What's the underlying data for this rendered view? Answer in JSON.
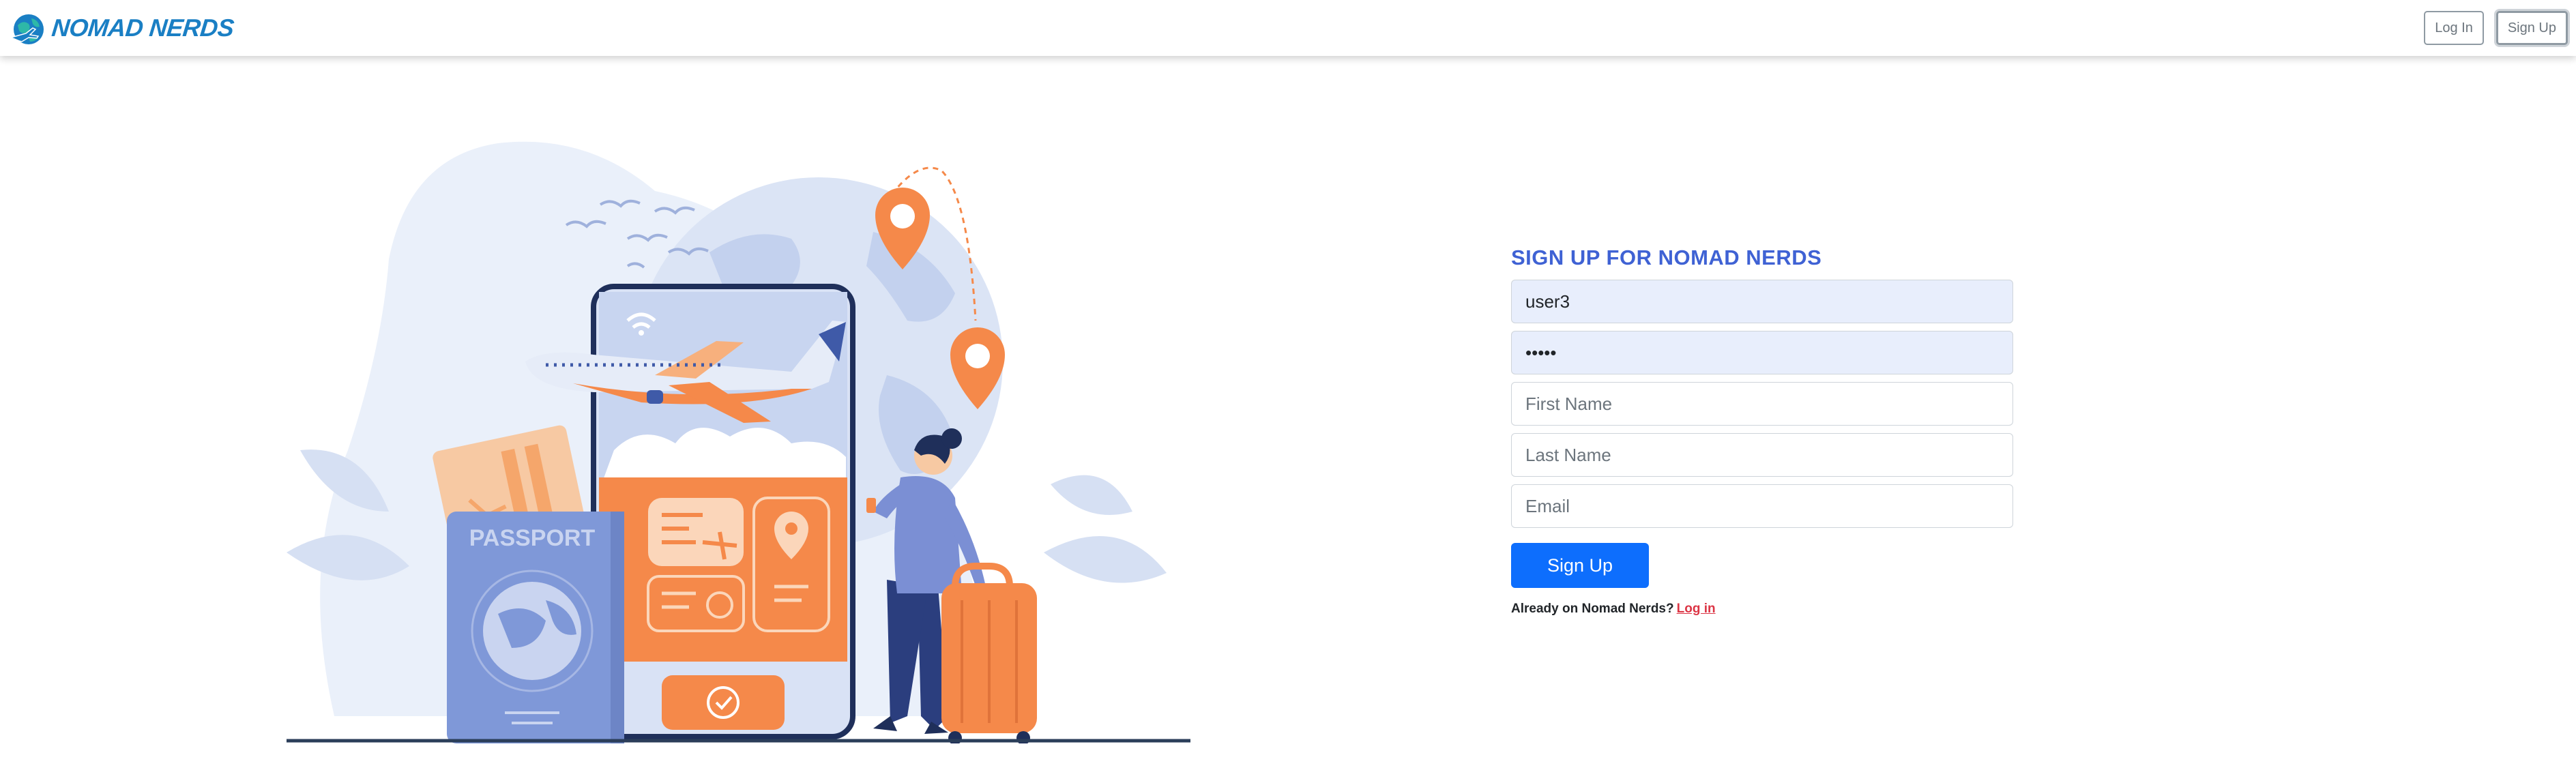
{
  "brand": {
    "name": "NOMAD NERDS",
    "logo_icon": "globe-plane-icon",
    "color": "#1a7fc4"
  },
  "nav": {
    "login_label": "Log In",
    "signup_label": "Sign Up"
  },
  "illustration": {
    "passport_text": "PASSPORT"
  },
  "form": {
    "title": "SIGN UP FOR NOMAD NERDS",
    "username_value": "user3",
    "password_value": "•••••",
    "first_name_placeholder": "First Name",
    "last_name_placeholder": "Last Name",
    "email_placeholder": "Email",
    "submit_label": "Sign Up",
    "already_text": "Already on Nomad Nerds?",
    "login_link": "Log in"
  },
  "colors": {
    "accent": "#0d6efd",
    "title": "#3f62d4",
    "link": "#dc3545",
    "orange": "#f5894a",
    "blue_illustration": "#7f98d8"
  }
}
